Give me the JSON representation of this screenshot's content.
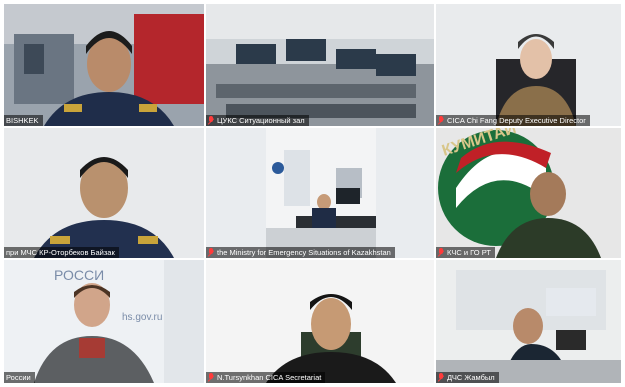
{
  "tiles": [
    {
      "label": "BISHKEK",
      "muted": false
    },
    {
      "label": "ЦУКС Ситуационный зал",
      "muted": true
    },
    {
      "label": "CICA Chi Fang Deputy Executive Director",
      "muted": true
    },
    {
      "label": "при МЧС КР-Оторбеков Байзак",
      "muted": false
    },
    {
      "label": "the Ministry for Emergency Situations of Kazakhstan",
      "muted": true
    },
    {
      "label": "КЧС и ГО РТ",
      "muted": true
    },
    {
      "label": "России",
      "muted": false
    },
    {
      "label": "N.Tursynkhan CICA Secretariat",
      "muted": true
    },
    {
      "label": "ДЧС Жамбыл",
      "muted": true
    }
  ],
  "banner_text": {
    "tile6": "КУМИТАИ",
    "tile7": "РОССИ",
    "tile7b": "hs.gov.ru"
  },
  "colors": {
    "active_border": "#c7d94a",
    "muted_icon": "#ff3b3b"
  }
}
